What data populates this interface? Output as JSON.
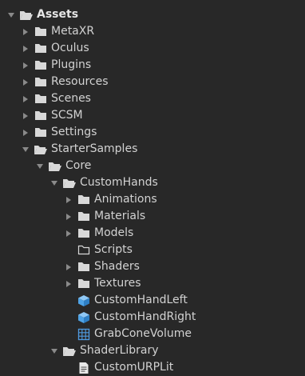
{
  "tree": {
    "root": {
      "label": "Assets",
      "icon": "folder-open-icon",
      "expanded": true
    },
    "items": [
      {
        "label": "MetaXR",
        "icon": "folder-icon",
        "expanded": false
      },
      {
        "label": "Oculus",
        "icon": "folder-icon",
        "expanded": false
      },
      {
        "label": "Plugins",
        "icon": "folder-icon",
        "expanded": false
      },
      {
        "label": "Resources",
        "icon": "folder-icon",
        "expanded": false
      },
      {
        "label": "Scenes",
        "icon": "folder-icon",
        "expanded": false
      },
      {
        "label": "SCSM",
        "icon": "folder-icon",
        "expanded": false
      },
      {
        "label": "Settings",
        "icon": "folder-icon",
        "expanded": false
      },
      {
        "label": "StarterSamples",
        "icon": "folder-open-icon",
        "expanded": true
      },
      {
        "label": "Core",
        "icon": "folder-open-icon",
        "expanded": true
      },
      {
        "label": "CustomHands",
        "icon": "folder-open-icon",
        "expanded": true
      },
      {
        "label": "Animations",
        "icon": "folder-icon",
        "expanded": false
      },
      {
        "label": "Materials",
        "icon": "folder-icon",
        "expanded": false
      },
      {
        "label": "Models",
        "icon": "folder-icon",
        "expanded": false
      },
      {
        "label": "Scripts",
        "icon": "empty-folder-icon"
      },
      {
        "label": "Shaders",
        "icon": "folder-icon",
        "expanded": false
      },
      {
        "label": "Textures",
        "icon": "folder-icon",
        "expanded": false
      },
      {
        "label": "CustomHandLeft",
        "icon": "prefab-cube-icon"
      },
      {
        "label": "CustomHandRight",
        "icon": "prefab-cube-icon"
      },
      {
        "label": "GrabConeVolume",
        "icon": "mesh-grid-icon"
      },
      {
        "label": "ShaderLibrary",
        "icon": "folder-open-icon",
        "expanded": true
      },
      {
        "label": "CustomURPLit",
        "icon": "shader-document-icon"
      }
    ]
  },
  "colors": {
    "background": "#282828",
    "text": "#d2d2d2",
    "arrow": "#8a8a8a",
    "folder": "#d8d8d8",
    "prefab": "#4fa3e6",
    "mesh": "#4f9be0"
  }
}
